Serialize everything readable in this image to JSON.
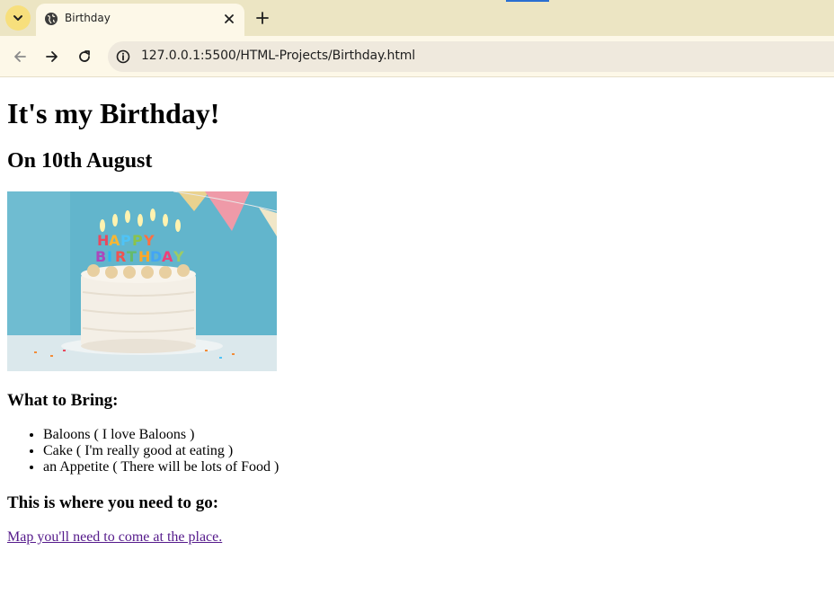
{
  "browser": {
    "tab": {
      "title": "Birthday",
      "favicon": "globe-icon"
    },
    "url": "127.0.0.1:5500/HTML-Projects/Birthday.html",
    "icons": {
      "tab_search": "chevron-down-icon",
      "close": "close-icon",
      "new_tab": "plus-icon",
      "back": "back-arrow-icon",
      "forward": "forward-arrow-icon",
      "reload": "reload-icon",
      "site_info": "info-icon"
    },
    "colors": {
      "tabstrip": "#ece5c3",
      "toolbar": "#fdf8e8",
      "accent": "#f7df7c"
    }
  },
  "page": {
    "title": "It's my Birthday!",
    "date": "On 10th August",
    "image_icon": "birthday-cake-photo",
    "bring_heading": "What to Bring:",
    "bring_items": [
      "Baloons ( I love Baloons )",
      "Cake ( I'm really good at eating )",
      "an Appetite ( There will be lots of Food )"
    ],
    "location_heading": "This is where you need to go:",
    "map_link": "Map you'll need to come at the place.",
    "colors": {
      "visited_link": "#551a8b"
    }
  }
}
